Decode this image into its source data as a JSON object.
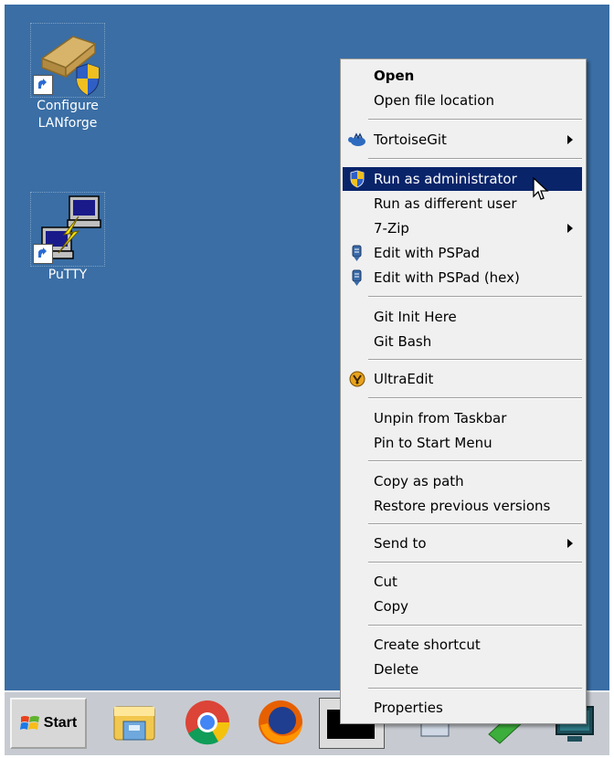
{
  "desktop": {
    "icons": [
      {
        "label_line1": "Configure",
        "label_line2": "LANforge"
      },
      {
        "label_line1": "PuTTY"
      }
    ]
  },
  "taskbar": {
    "start_label": "Start"
  },
  "context_menu": {
    "items": [
      {
        "label": "Open",
        "bold": true
      },
      {
        "label": "Open file location"
      },
      {
        "label": "TortoiseGit",
        "submenu": true,
        "icon": "tortoisegit-icon"
      },
      {
        "label": "Run as administrator",
        "icon": "uac-shield-icon",
        "selected": true
      },
      {
        "label": "Run as different user"
      },
      {
        "label": "7-Zip",
        "submenu": true
      },
      {
        "label": "Edit with PSPad",
        "icon": "pspad-icon"
      },
      {
        "label": "Edit with PSPad (hex)",
        "icon": "pspad-icon"
      },
      {
        "label": "Git Init Here"
      },
      {
        "label": "Git Bash"
      },
      {
        "label": "UltraEdit",
        "icon": "ultraedit-icon"
      },
      {
        "label": "Unpin from Taskbar"
      },
      {
        "label": "Pin to Start Menu"
      },
      {
        "label": "Copy as path"
      },
      {
        "label": "Restore previous versions"
      },
      {
        "label": "Send to",
        "submenu": true
      },
      {
        "label": "Cut"
      },
      {
        "label": "Copy"
      },
      {
        "label": "Create shortcut"
      },
      {
        "label": "Delete"
      },
      {
        "label": "Properties"
      }
    ]
  },
  "colors": {
    "desktop_bg": "#3a6ea5",
    "menu_bg": "#f0f0f0",
    "selection_bg": "#0a246a"
  }
}
